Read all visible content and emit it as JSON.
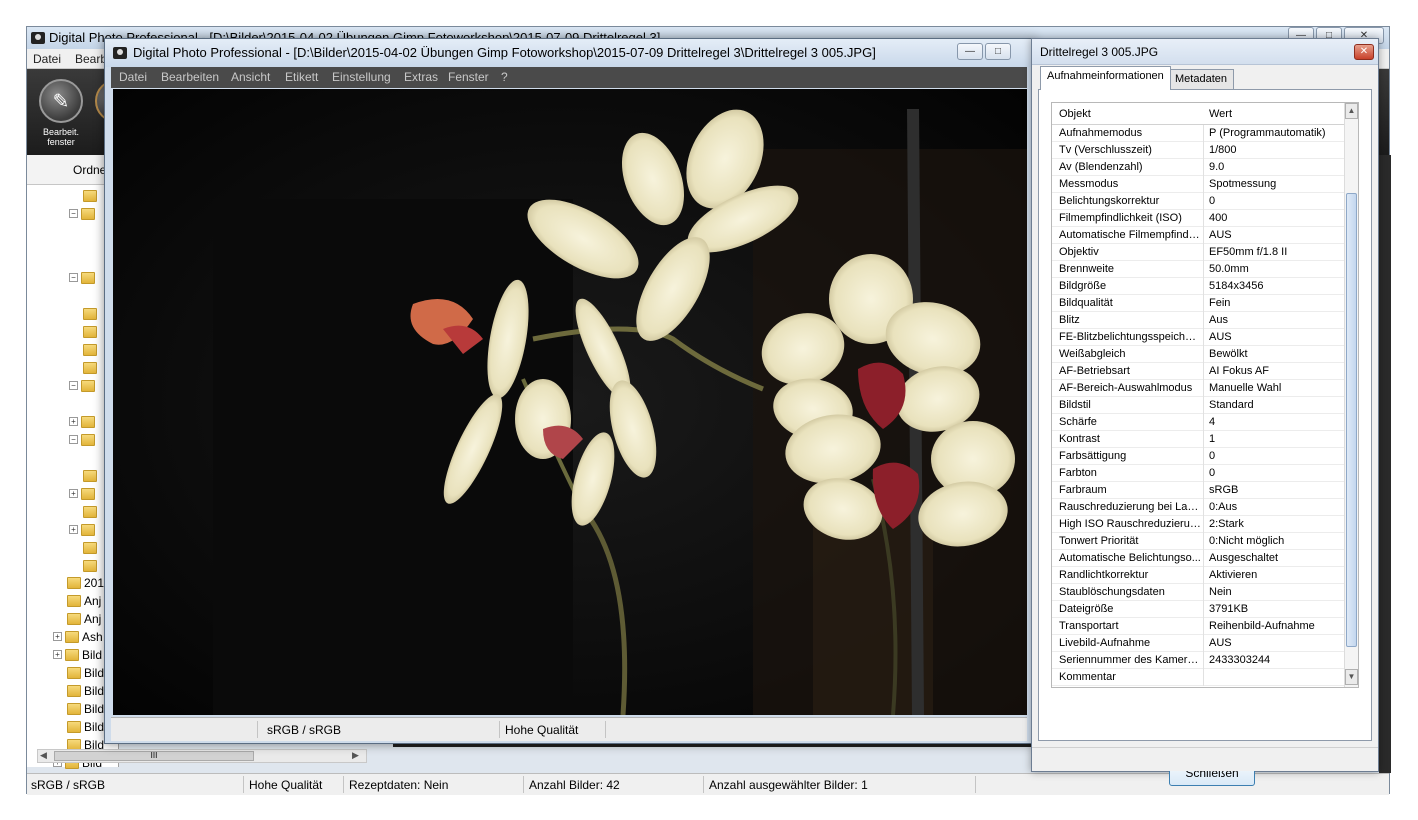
{
  "background_window": {
    "title": "Digital Photo Professional - [D:\\Bilder\\2015-04-02 Übungen Gimp Fotoworkshop\\2015-07-09 Drittelregel 3]",
    "menu": [
      "Datei",
      "Bearb"
    ],
    "toolbar": {
      "edit_label_1": "Bearbeit.",
      "edit_label_2": "fenster"
    },
    "left_header": "Ordne",
    "tree_items": [
      "201",
      "Anj",
      "Anj",
      "Ash",
      "Bild",
      "Bild",
      "Bild",
      "Bild",
      "Bild",
      "Bild",
      "Bild"
    ],
    "hscroll_thumb": "III",
    "status": {
      "color_space": "sRGB / sRGB",
      "quality": "Hohe Qualität",
      "recipe": "Rezeptdaten: Nein",
      "image_count": "Anzahl Bilder: 42",
      "selected_count": "Anzahl ausgewählter Bilder: 1"
    }
  },
  "image_window": {
    "title": "Digital Photo Professional - [D:\\Bilder\\2015-04-02 Übungen  Gimp Fotoworkshop\\2015-07-09 Drittelregel 3\\Drittelregel 3 005.JPG]",
    "menu": [
      "Datei",
      "Bearbeiten",
      "Ansicht",
      "Etikett",
      "Einstellung",
      "Extras",
      "Fenster",
      "?"
    ],
    "status": {
      "color_space": "sRGB / sRGB",
      "quality": "Hohe Qualität"
    }
  },
  "dialog": {
    "title": "Drittelregel 3 005.JPG",
    "tabs": [
      "Aufnahmeinformationen",
      "Metadaten"
    ],
    "columns": {
      "key": "Objekt",
      "value": "Wert"
    },
    "rows": [
      {
        "k": "Aufnahmemodus",
        "v": "P (Programmautomatik)"
      },
      {
        "k": "Tv (Verschlusszeit)",
        "v": "1/800"
      },
      {
        "k": "Av (Blendenzahl)",
        "v": "9.0"
      },
      {
        "k": "Messmodus",
        "v": "Spotmessung"
      },
      {
        "k": "Belichtungskorrektur",
        "v": "0"
      },
      {
        "k": "Filmempfindlichkeit (ISO)",
        "v": "400"
      },
      {
        "k": "Automatische Filmempfindli...",
        "v": "AUS"
      },
      {
        "k": "Objektiv",
        "v": "EF50mm f/1.8 II"
      },
      {
        "k": "Brennweite",
        "v": "50.0mm"
      },
      {
        "k": "Bildgröße",
        "v": "5184x3456"
      },
      {
        "k": "Bildqualität",
        "v": "Fein"
      },
      {
        "k": "Blitz",
        "v": "Aus"
      },
      {
        "k": "FE-Blitzbelichtungsspeicher...",
        "v": "AUS"
      },
      {
        "k": "Weißabgleich",
        "v": "Bewölkt"
      },
      {
        "k": "AF-Betriebsart",
        "v": "AI Fokus AF"
      },
      {
        "k": "AF-Bereich-Auswahlmodus",
        "v": "Manuelle  Wahl"
      },
      {
        "k": "Bildstil",
        "v": "Standard"
      },
      {
        "k": "Schärfe",
        "v": "4"
      },
      {
        "k": "Kontrast",
        "v": "1"
      },
      {
        "k": "Farbsättigung",
        "v": "0"
      },
      {
        "k": "Farbton",
        "v": "0"
      },
      {
        "k": "Farbraum",
        "v": "sRGB"
      },
      {
        "k": "Rauschreduzierung bei Lan...",
        "v": "0:Aus"
      },
      {
        "k": "High ISO Rauschreduzierung",
        "v": "2:Stark"
      },
      {
        "k": "Tonwert Priorität",
        "v": "0:Nicht möglich"
      },
      {
        "k": "Automatische Belichtungso...",
        "v": "Ausgeschaltet"
      },
      {
        "k": "Randlichtkorrektur",
        "v": "Aktivieren"
      },
      {
        "k": "Staublöschungsdaten",
        "v": "Nein"
      },
      {
        "k": "Dateigröße",
        "v": "3791KB"
      },
      {
        "k": "Transportart",
        "v": "Reihenbild-Aufnahme"
      },
      {
        "k": "Livebild-Aufnahme",
        "v": "AUS"
      },
      {
        "k": "Seriennummer des Kamera...",
        "v": "2433303244"
      },
      {
        "k": "Kommentar",
        "v": ""
      }
    ],
    "close_button": "Schließen"
  },
  "colors": {
    "accent": "#3c7fb1",
    "photo_bg": "#050505",
    "toolbar_bg": "#1c1c1c"
  }
}
